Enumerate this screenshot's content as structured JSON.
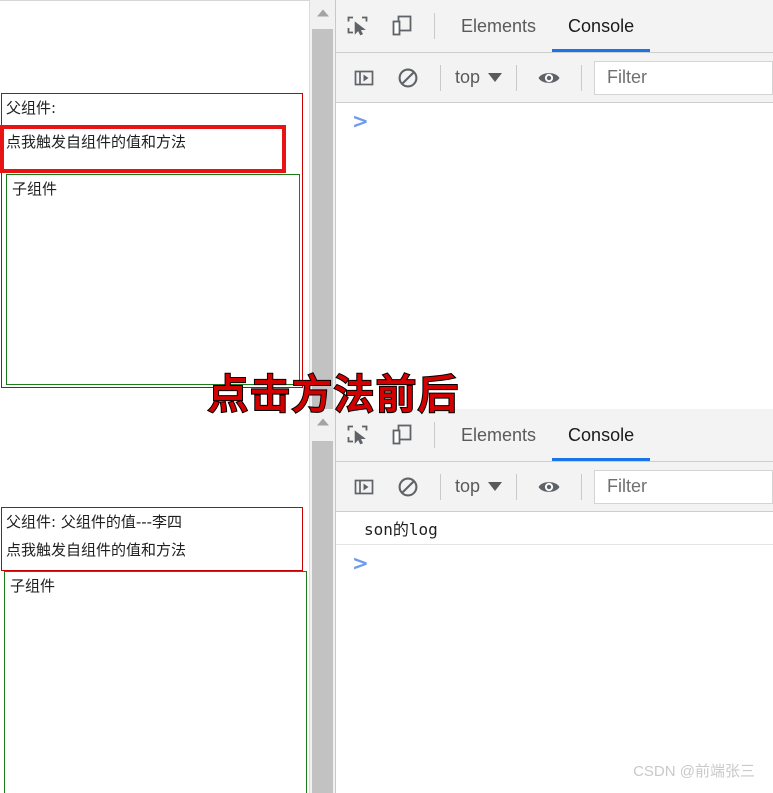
{
  "overlay": {
    "caption": "点击方法前后"
  },
  "watermark": {
    "text": "CSDN @前端张三"
  },
  "before": {
    "page": {
      "parent_label": "父组件:",
      "button_text": "点我触发自组件的值和方法",
      "child_label": "子组件",
      "parent_border_color": "#cc0000",
      "child_border_color": "#1a7d1a",
      "annotation_color": "#e81313"
    },
    "devtools": {
      "icons": {
        "inspect": "inspect-element-icon",
        "device": "device-toolbar-icon",
        "sidebar": "console-sidebar-icon",
        "clear": "clear-console-icon",
        "eye": "live-expression-icon"
      },
      "tabs": [
        {
          "label": "Elements",
          "selected": false
        },
        {
          "label": "Console",
          "selected": true
        }
      ],
      "context": "top",
      "filter_placeholder": "Filter",
      "logs": [],
      "prompt": ">"
    }
  },
  "after": {
    "page": {
      "parent_label": "父组件: 父组件的值---李四",
      "button_text": "点我触发自组件的值和方法",
      "child_label": "子组件",
      "parent_border_color": "#cc0000",
      "child_border_color": "#1a7d1a"
    },
    "devtools": {
      "icons": {
        "inspect": "inspect-element-icon",
        "device": "device-toolbar-icon",
        "sidebar": "console-sidebar-icon",
        "clear": "clear-console-icon",
        "eye": "live-expression-icon"
      },
      "tabs": [
        {
          "label": "Elements",
          "selected": false
        },
        {
          "label": "Console",
          "selected": true
        }
      ],
      "context": "top",
      "filter_placeholder": "Filter",
      "logs": [
        "son的log"
      ],
      "prompt": ">"
    }
  }
}
